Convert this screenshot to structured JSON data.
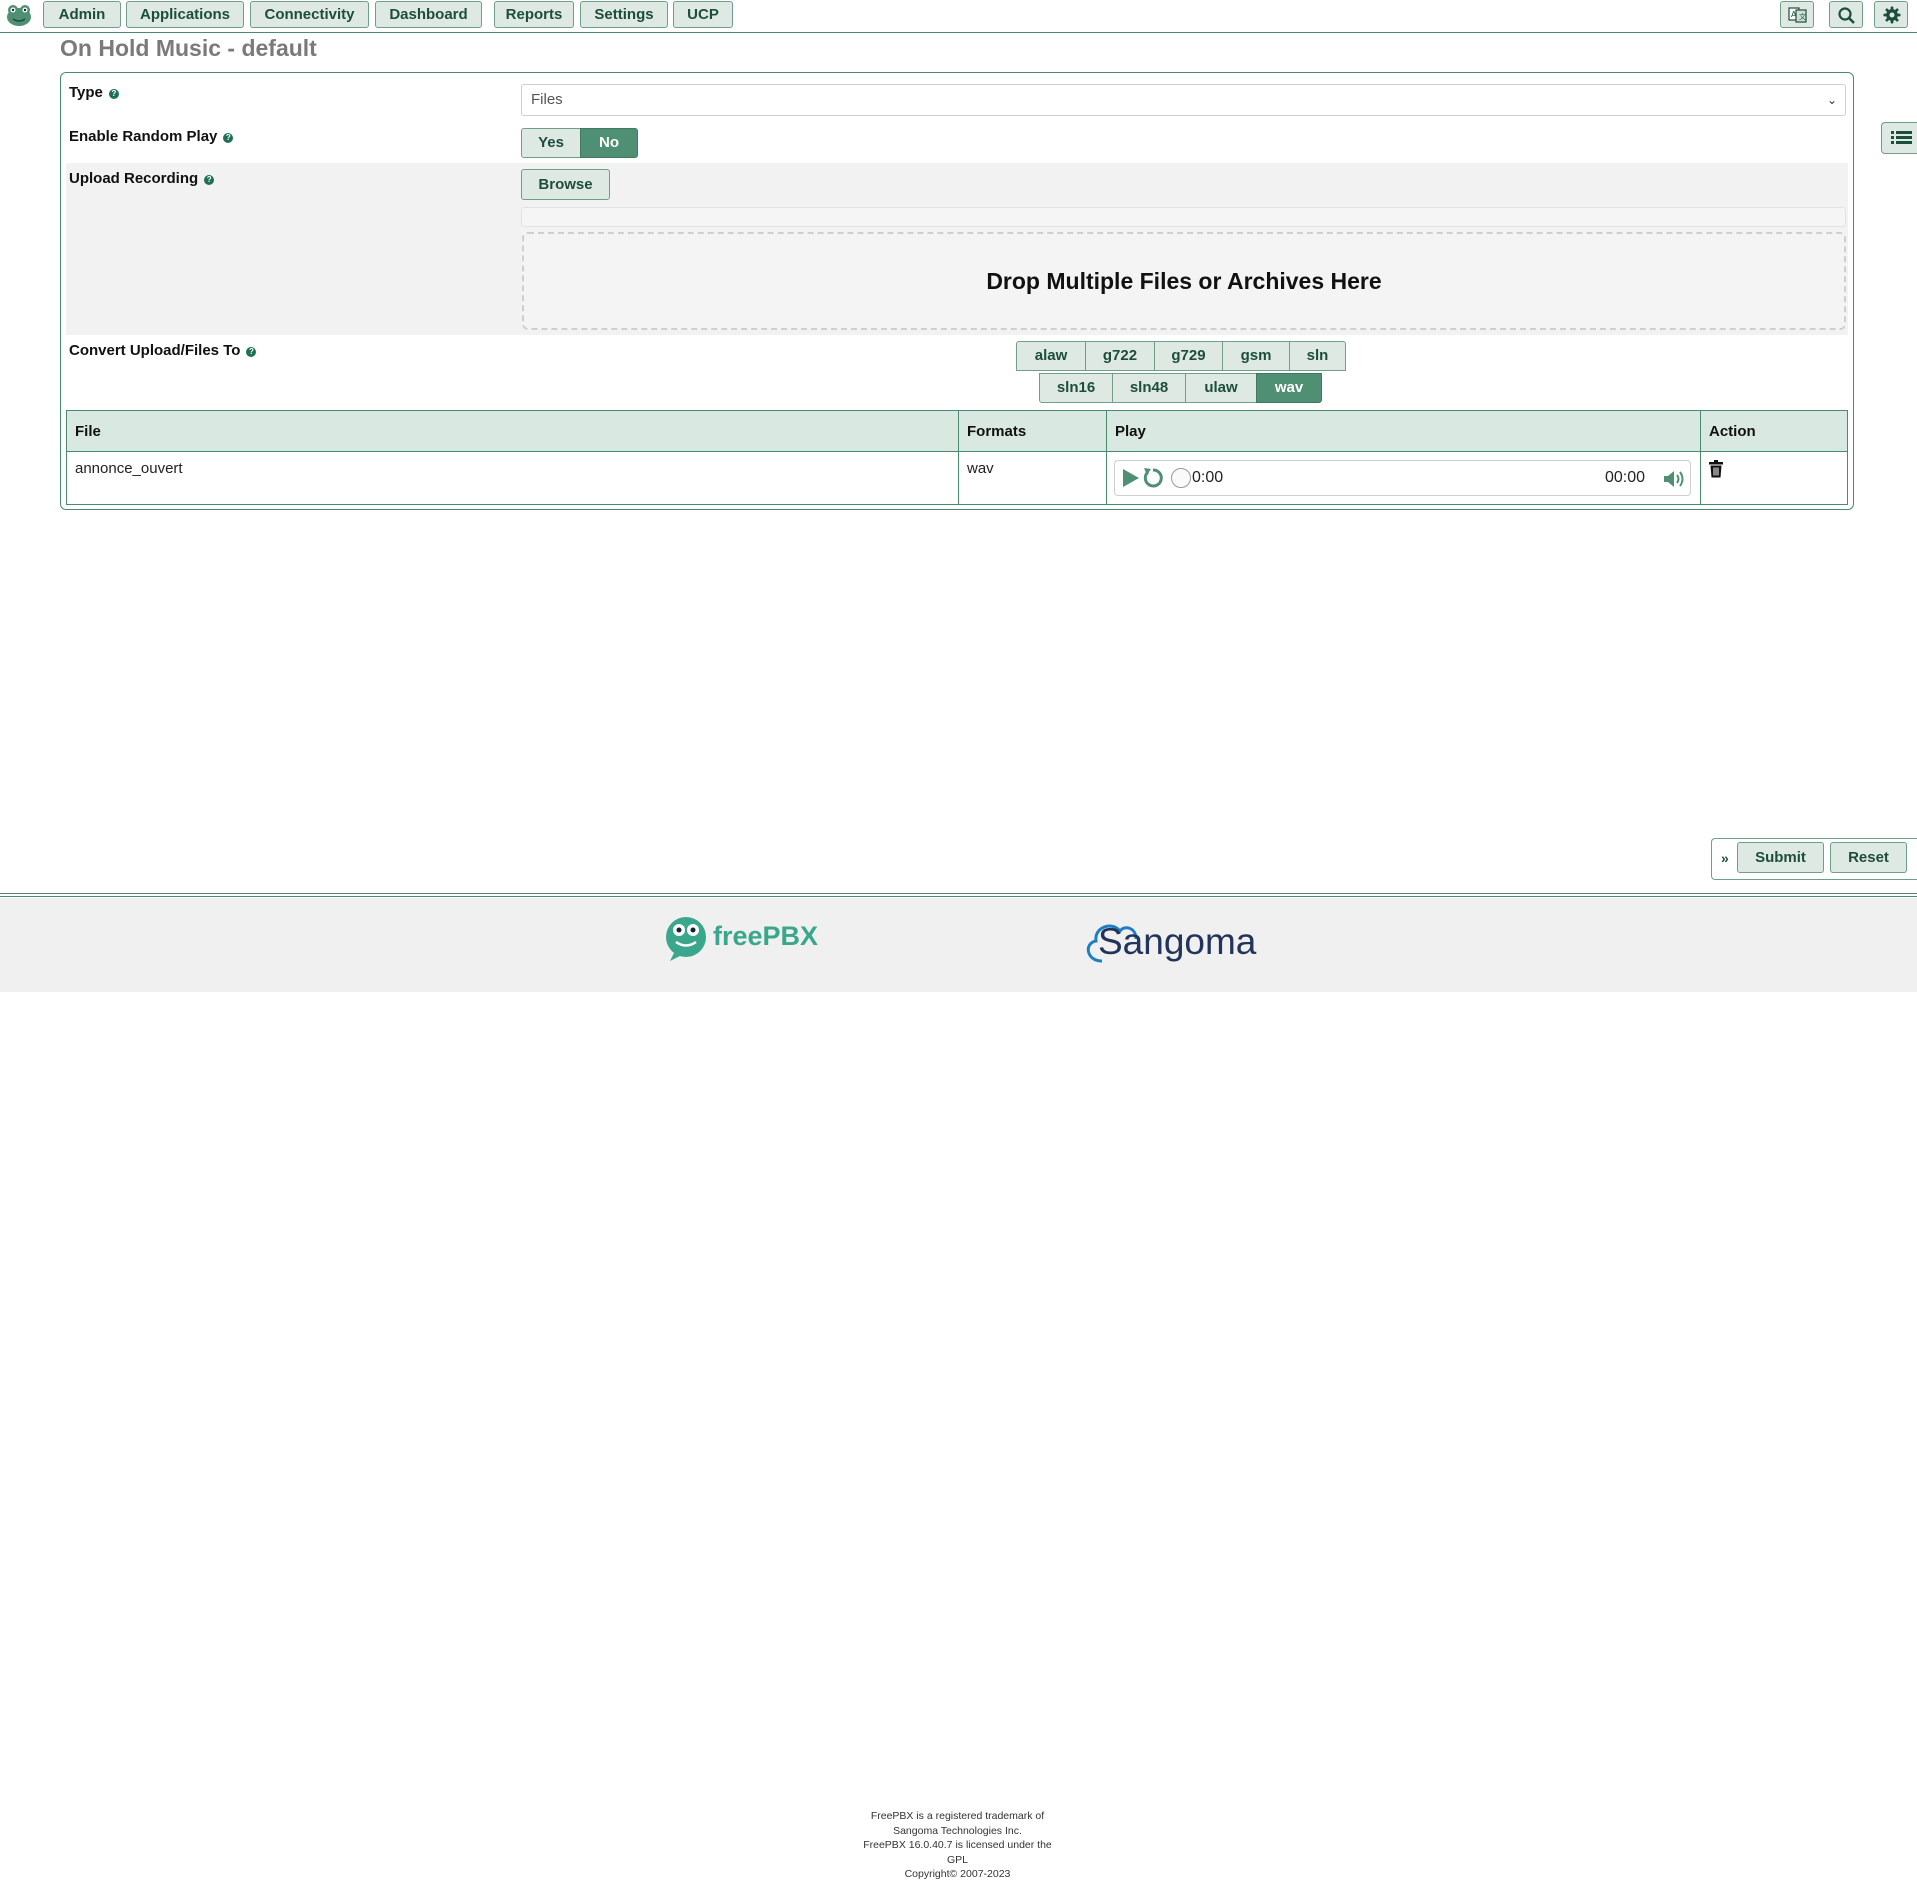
{
  "nav": {
    "items": [
      "Admin",
      "Applications",
      "Connectivity",
      "Dashboard",
      "Reports",
      "Settings",
      "UCP"
    ],
    "icons": [
      "language-icon",
      "search-icon",
      "gear-icon"
    ]
  },
  "page": {
    "title": "On Hold Music - default"
  },
  "form": {
    "type": {
      "label": "Type",
      "value": "Files"
    },
    "random_play": {
      "label": "Enable Random Play",
      "options": [
        "Yes",
        "No"
      ],
      "selected": "No"
    },
    "upload": {
      "label": "Upload Recording",
      "browse": "Browse",
      "dropzone": "Drop Multiple Files or Archives Here"
    },
    "convert": {
      "label": "Convert Upload/Files To",
      "row1": [
        "alaw",
        "g722",
        "g729",
        "gsm",
        "sln"
      ],
      "row2": [
        "sln16",
        "sln48",
        "ulaw",
        "wav"
      ],
      "selected": [
        "wav"
      ]
    }
  },
  "table": {
    "headers": [
      "File",
      "Formats",
      "Play",
      "Action"
    ],
    "rows": [
      {
        "file": "annonce_ouvert",
        "formats": "wav",
        "elapsed": "0:00",
        "duration": "00:00"
      }
    ]
  },
  "actions": {
    "submit": "Submit",
    "reset": "Reset"
  },
  "footer": {
    "freepbx_brand": "freePBX",
    "sangoma_brand": "Sangoma",
    "legal": [
      "FreePBX is a registered trademark of",
      "Sangoma Technologies Inc.",
      "FreePBX 16.0.40.7 is licensed under the",
      "GPL",
      "Copyright© 2007-2023"
    ]
  },
  "colors": {
    "accent": "#4f8f73",
    "button_bg": "#dfe9e4",
    "border": "#4a8a6e",
    "header_bg": "#d9e8e0"
  }
}
